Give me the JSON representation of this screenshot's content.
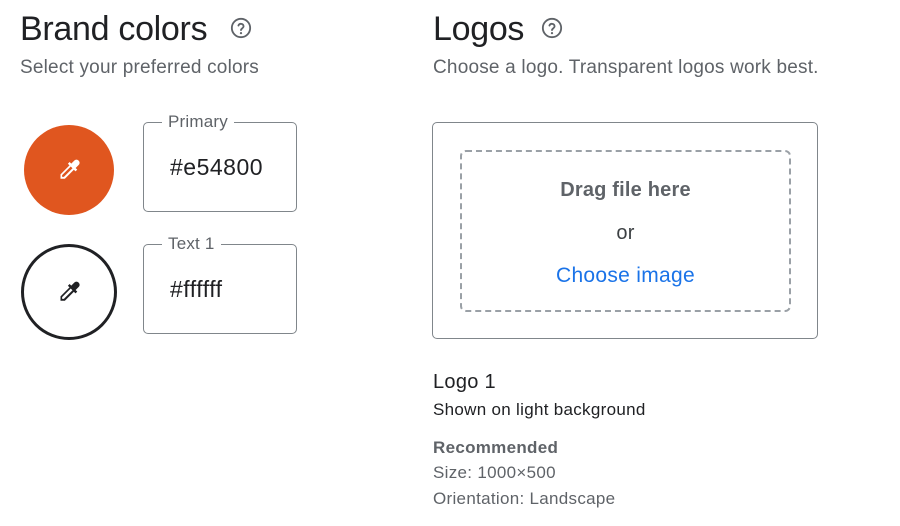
{
  "brand": {
    "title": "Brand colors",
    "subtitle": "Select your preferred colors",
    "colors": [
      {
        "label": "Primary",
        "value": "#e54800",
        "swatch_color": "#e0561f",
        "icon_color": "#ffffff"
      },
      {
        "label": "Text 1",
        "value": "#ffffff",
        "swatch_color": "#ffffff",
        "icon_color": "#202124"
      }
    ],
    "icons": {
      "help": "help-circle-icon",
      "picker": "eyedropper-icon"
    }
  },
  "logos": {
    "title": "Logos",
    "subtitle": "Choose a logo. Transparent logos work best.",
    "dropzone": {
      "drag_text": "Drag file here",
      "or_text": "or",
      "choose_label": "Choose image"
    },
    "logo": {
      "title": "Logo 1",
      "description": "Shown on light background",
      "recommended_heading": "Recommended",
      "size": "Size: 1000×500",
      "orientation": "Orientation: Landscape"
    }
  },
  "colors": {
    "link": "#1a73e8",
    "border": "#80868b",
    "muted_text": "#5f6368"
  }
}
